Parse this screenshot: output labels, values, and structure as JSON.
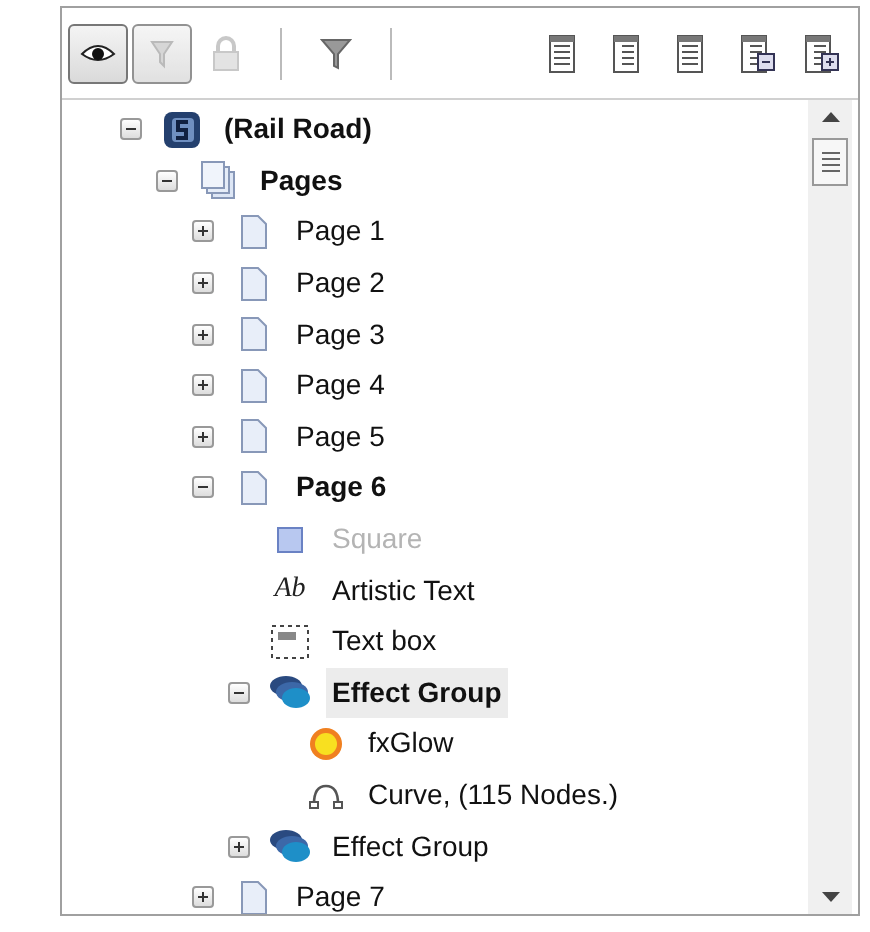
{
  "toolbar": [
    {
      "kind": "eye",
      "pressed": true,
      "disabled": false
    },
    {
      "kind": "pen-filter",
      "pressed": true,
      "disabled": true
    },
    {
      "kind": "lock",
      "pressed": false,
      "disabled": true
    },
    {
      "kind": "separator"
    },
    {
      "kind": "funnel",
      "pressed": false,
      "disabled": false
    },
    {
      "kind": "separator"
    },
    {
      "kind": "view-details",
      "pressed": false,
      "disabled": false
    },
    {
      "kind": "view-tree",
      "pressed": false,
      "disabled": false
    },
    {
      "kind": "view-list",
      "pressed": false,
      "disabled": false
    },
    {
      "kind": "collapse-all",
      "pressed": false,
      "disabled": false
    },
    {
      "kind": "expand-all",
      "pressed": false,
      "disabled": false
    }
  ],
  "tree": [
    {
      "label": "(Rail Road)",
      "kind": "document",
      "expanded": true,
      "selected": false,
      "dimmed": false,
      "children": [
        {
          "label": "Pages",
          "kind": "pages",
          "expanded": true,
          "selected": false,
          "dimmed": false,
          "children": [
            {
              "label": "Page 1",
              "kind": "page",
              "expanded": false,
              "selected": false,
              "dimmed": false
            },
            {
              "label": "Page 2",
              "kind": "page",
              "expanded": false,
              "selected": false,
              "dimmed": false
            },
            {
              "label": "Page 3",
              "kind": "page",
              "expanded": false,
              "selected": false,
              "dimmed": false
            },
            {
              "label": "Page 4",
              "kind": "page",
              "expanded": false,
              "selected": false,
              "dimmed": false
            },
            {
              "label": "Page 5",
              "kind": "page",
              "expanded": false,
              "selected": false,
              "dimmed": false
            },
            {
              "label": "Page 6",
              "kind": "page",
              "expanded": true,
              "selected": false,
              "dimmed": false,
              "children": [
                {
                  "label": "Square",
                  "kind": "rectangle",
                  "selected": false,
                  "dimmed": true
                },
                {
                  "label": "Artistic Text",
                  "kind": "artistic-text",
                  "icon_text": "Ab",
                  "selected": false,
                  "dimmed": false
                },
                {
                  "label": "Text box",
                  "kind": "text-box",
                  "selected": false,
                  "dimmed": false
                },
                {
                  "label": "Effect Group",
                  "kind": "effect-group",
                  "expanded": true,
                  "selected": true,
                  "dimmed": false,
                  "children": [
                    {
                      "label": "fxGlow",
                      "kind": "glow",
                      "selected": false,
                      "dimmed": false
                    },
                    {
                      "label": "Curve, (115 Nodes.)",
                      "kind": "curve",
                      "selected": false,
                      "dimmed": false
                    }
                  ]
                },
                {
                  "label": "Effect Group",
                  "kind": "effect-group",
                  "expanded": false,
                  "selected": false,
                  "dimmed": false
                }
              ]
            },
            {
              "label": "Page 7",
              "kind": "page",
              "expanded": false,
              "selected": false,
              "dimmed": false
            }
          ]
        }
      ]
    }
  ]
}
